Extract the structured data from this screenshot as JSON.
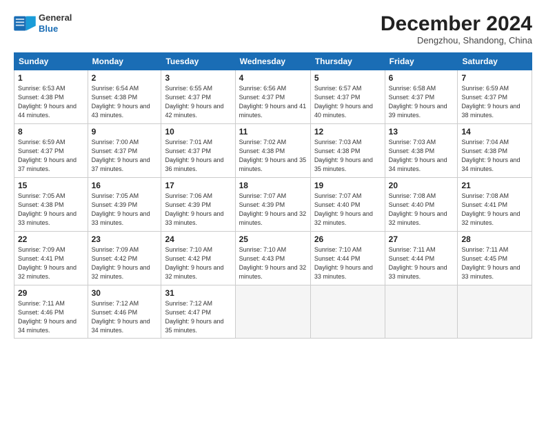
{
  "header": {
    "logo_line1": "General",
    "logo_line2": "Blue",
    "month_title": "December 2024",
    "location": "Dengzhou, Shandong, China"
  },
  "days_of_week": [
    "Sunday",
    "Monday",
    "Tuesday",
    "Wednesday",
    "Thursday",
    "Friday",
    "Saturday"
  ],
  "weeks": [
    [
      {
        "day": "1",
        "sunrise": "6:53 AM",
        "sunset": "4:38 PM",
        "daylight": "9 hours and 44 minutes."
      },
      {
        "day": "2",
        "sunrise": "6:54 AM",
        "sunset": "4:38 PM",
        "daylight": "9 hours and 43 minutes."
      },
      {
        "day": "3",
        "sunrise": "6:55 AM",
        "sunset": "4:37 PM",
        "daylight": "9 hours and 42 minutes."
      },
      {
        "day": "4",
        "sunrise": "6:56 AM",
        "sunset": "4:37 PM",
        "daylight": "9 hours and 41 minutes."
      },
      {
        "day": "5",
        "sunrise": "6:57 AM",
        "sunset": "4:37 PM",
        "daylight": "9 hours and 40 minutes."
      },
      {
        "day": "6",
        "sunrise": "6:58 AM",
        "sunset": "4:37 PM",
        "daylight": "9 hours and 39 minutes."
      },
      {
        "day": "7",
        "sunrise": "6:59 AM",
        "sunset": "4:37 PM",
        "daylight": "9 hours and 38 minutes."
      }
    ],
    [
      {
        "day": "8",
        "sunrise": "6:59 AM",
        "sunset": "4:37 PM",
        "daylight": "9 hours and 37 minutes."
      },
      {
        "day": "9",
        "sunrise": "7:00 AM",
        "sunset": "4:37 PM",
        "daylight": "9 hours and 37 minutes."
      },
      {
        "day": "10",
        "sunrise": "7:01 AM",
        "sunset": "4:37 PM",
        "daylight": "9 hours and 36 minutes."
      },
      {
        "day": "11",
        "sunrise": "7:02 AM",
        "sunset": "4:38 PM",
        "daylight": "9 hours and 35 minutes."
      },
      {
        "day": "12",
        "sunrise": "7:03 AM",
        "sunset": "4:38 PM",
        "daylight": "9 hours and 35 minutes."
      },
      {
        "day": "13",
        "sunrise": "7:03 AM",
        "sunset": "4:38 PM",
        "daylight": "9 hours and 34 minutes."
      },
      {
        "day": "14",
        "sunrise": "7:04 AM",
        "sunset": "4:38 PM",
        "daylight": "9 hours and 34 minutes."
      }
    ],
    [
      {
        "day": "15",
        "sunrise": "7:05 AM",
        "sunset": "4:38 PM",
        "daylight": "9 hours and 33 minutes."
      },
      {
        "day": "16",
        "sunrise": "7:05 AM",
        "sunset": "4:39 PM",
        "daylight": "9 hours and 33 minutes."
      },
      {
        "day": "17",
        "sunrise": "7:06 AM",
        "sunset": "4:39 PM",
        "daylight": "9 hours and 33 minutes."
      },
      {
        "day": "18",
        "sunrise": "7:07 AM",
        "sunset": "4:39 PM",
        "daylight": "9 hours and 32 minutes."
      },
      {
        "day": "19",
        "sunrise": "7:07 AM",
        "sunset": "4:40 PM",
        "daylight": "9 hours and 32 minutes."
      },
      {
        "day": "20",
        "sunrise": "7:08 AM",
        "sunset": "4:40 PM",
        "daylight": "9 hours and 32 minutes."
      },
      {
        "day": "21",
        "sunrise": "7:08 AM",
        "sunset": "4:41 PM",
        "daylight": "9 hours and 32 minutes."
      }
    ],
    [
      {
        "day": "22",
        "sunrise": "7:09 AM",
        "sunset": "4:41 PM",
        "daylight": "9 hours and 32 minutes."
      },
      {
        "day": "23",
        "sunrise": "7:09 AM",
        "sunset": "4:42 PM",
        "daylight": "9 hours and 32 minutes."
      },
      {
        "day": "24",
        "sunrise": "7:10 AM",
        "sunset": "4:42 PM",
        "daylight": "9 hours and 32 minutes."
      },
      {
        "day": "25",
        "sunrise": "7:10 AM",
        "sunset": "4:43 PM",
        "daylight": "9 hours and 32 minutes."
      },
      {
        "day": "26",
        "sunrise": "7:10 AM",
        "sunset": "4:44 PM",
        "daylight": "9 hours and 33 minutes."
      },
      {
        "day": "27",
        "sunrise": "7:11 AM",
        "sunset": "4:44 PM",
        "daylight": "9 hours and 33 minutes."
      },
      {
        "day": "28",
        "sunrise": "7:11 AM",
        "sunset": "4:45 PM",
        "daylight": "9 hours and 33 minutes."
      }
    ],
    [
      {
        "day": "29",
        "sunrise": "7:11 AM",
        "sunset": "4:46 PM",
        "daylight": "9 hours and 34 minutes."
      },
      {
        "day": "30",
        "sunrise": "7:12 AM",
        "sunset": "4:46 PM",
        "daylight": "9 hours and 34 minutes."
      },
      {
        "day": "31",
        "sunrise": "7:12 AM",
        "sunset": "4:47 PM",
        "daylight": "9 hours and 35 minutes."
      },
      null,
      null,
      null,
      null
    ]
  ]
}
